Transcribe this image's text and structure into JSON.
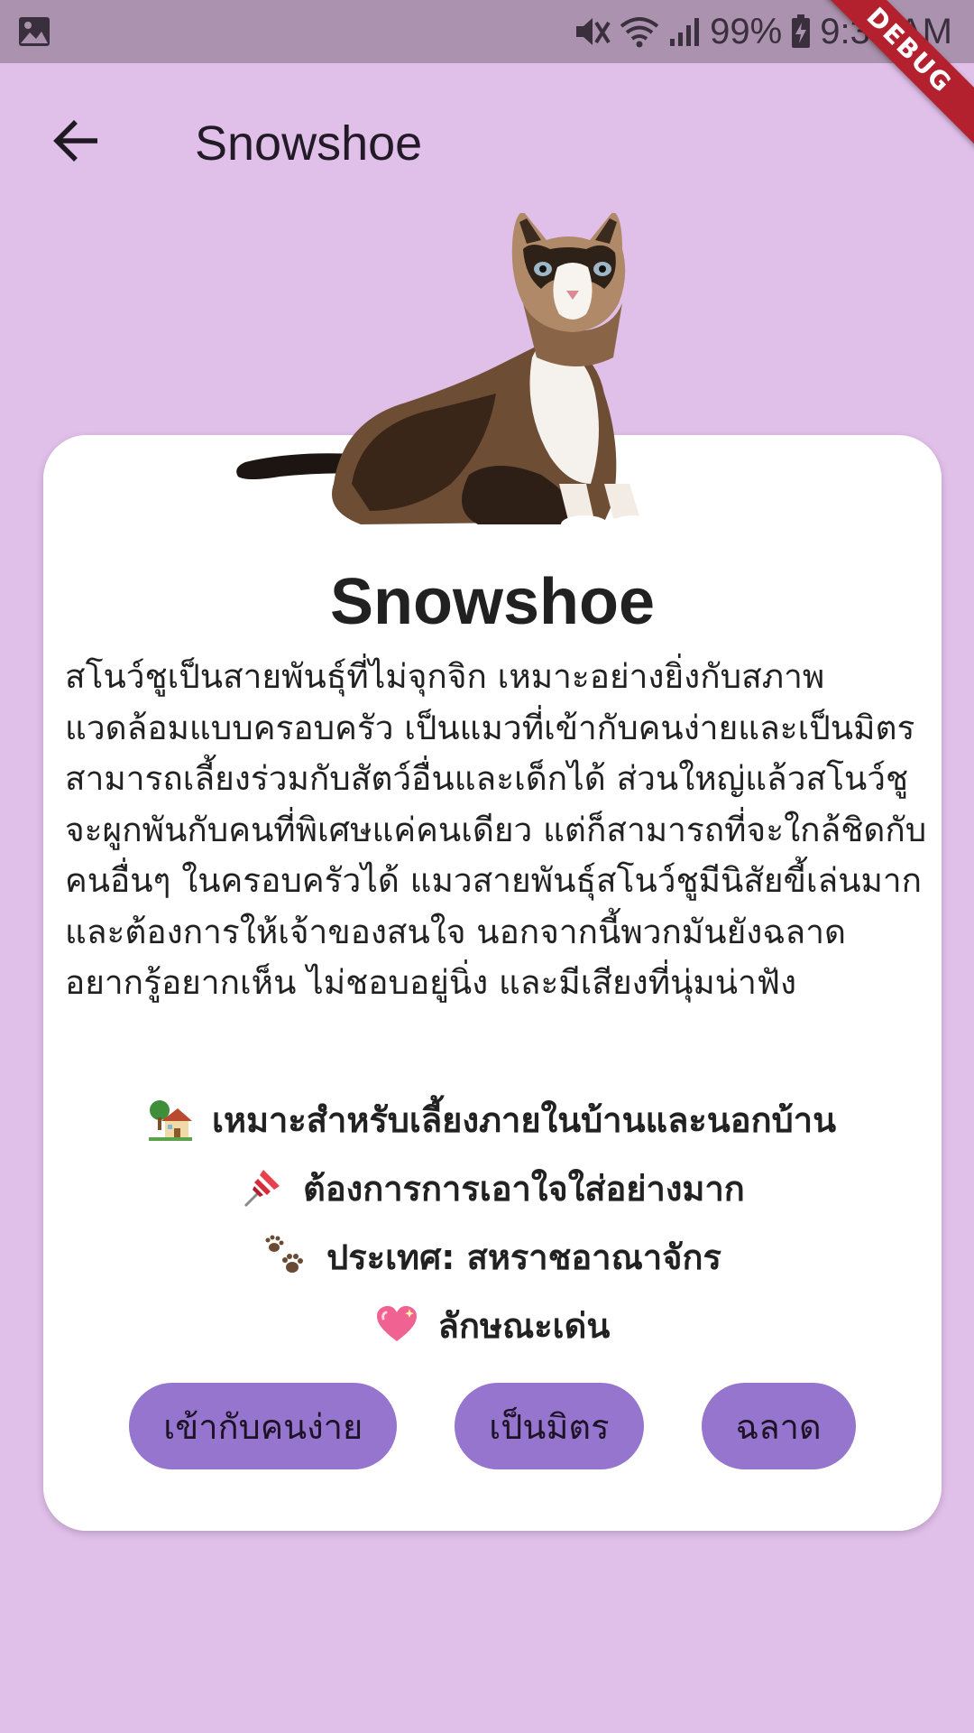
{
  "status_bar": {
    "battery": "99%",
    "time": "9:35 AM",
    "debug_label": "DEBUG"
  },
  "app_bar": {
    "back_icon": "arrow-back-icon",
    "title": "Snowshoe"
  },
  "breed": {
    "image_icon": "snowshoe-cat-photo",
    "name": "Snowshoe",
    "description": "สโนว์ชูเป็นสายพันธุ์ที่ไม่จุกจิก เหมาะอย่างยิ่งกับสภาพแวดล้อมแบบครอบครัว เป็นแมวที่เข้ากับคนง่ายและเป็นมิตร สามารถเลี้ยงร่วมกับสัตว์อื่นและเด็กได้ ส่วนใหญ่แล้วสโนว์ชูจะผูกพันกับคนที่พิเศษแค่คนเดียว แต่ก็สามารถที่จะใกล้ชิดกับคนอื่นๆ ในครอบครัวได้ แมวสายพันธุ์สโนว์ชูมีนิสัยขี้เล่นมากและต้องการให้เจ้าของสนใจ นอกจากนี้พวกมันยังฉลาด อยากรู้อยากเห็น ไม่ชอบอยู่นิ่ง และมีเสียงที่นุ่มน่าฟัง",
    "facts": [
      {
        "icon": "house-with-garden-icon",
        "text": "เหมาะสำหรับเลี้ยงภายในบ้านและนอกบ้าน"
      },
      {
        "icon": "pushpin-icon",
        "text": "ต้องการการเอาใจใส่อย่างมาก"
      },
      {
        "icon": "paw-prints-icon",
        "text": "ประเทศ: สหราชอาณาจักร"
      },
      {
        "icon": "sparkling-heart-icon",
        "text": "ลักษณะเด่น"
      }
    ],
    "tags": [
      "เข้ากับคนง่าย",
      "เป็นมิตร",
      "ฉลาด"
    ]
  },
  "colors": {
    "background": "#e0bfe9",
    "status_bar": "#ab92ae",
    "card": "#ffffff",
    "chip": "#9575cd",
    "debug_banner": "#b3202e"
  }
}
